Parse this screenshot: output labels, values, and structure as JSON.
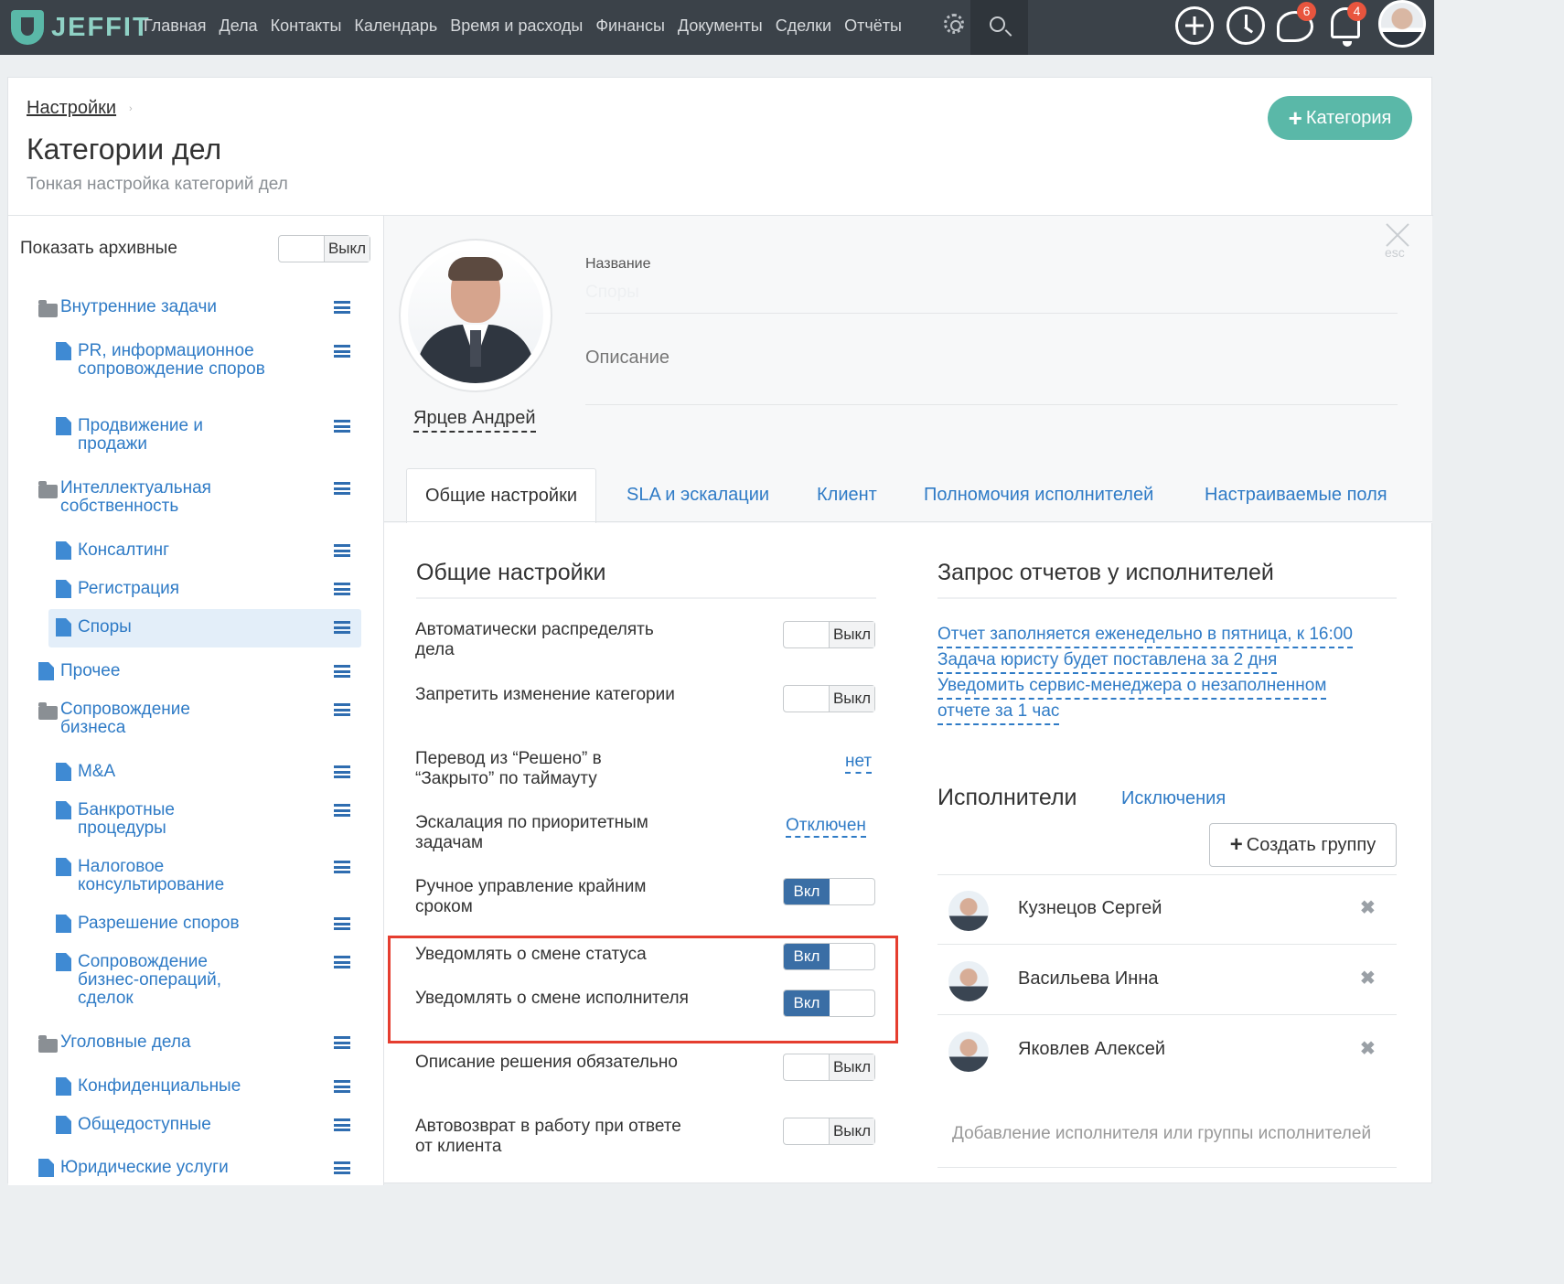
{
  "app": {
    "brand": "JEFFIT"
  },
  "nav": [
    "Главная",
    "Дела",
    "Контакты",
    "Календарь",
    "Время и расходы",
    "Финансы",
    "Документы",
    "Сделки",
    "Отчёты"
  ],
  "badges": {
    "messages": "6",
    "notifications": "4"
  },
  "page": {
    "breadcrumb": "Настройки",
    "breadcrumb_sep": "›",
    "title": "Категории дел",
    "subtitle": "Тонкая настройка категорий дел",
    "add_button_icon": "+",
    "add_button": "Категория"
  },
  "sidebar": {
    "show_archived": "Показать архивные",
    "archived_toggle": "Выкл",
    "items": [
      "Внутренние задачи",
      "PR, информационное сопровождение споров",
      "Продвижение и продажи",
      "Интеллектуальная собственность",
      "Консалтинг",
      "Регистрация",
      "Споры",
      "Прочее",
      "Сопровождение бизнеса",
      "M&A",
      "Банкротные процедуры",
      "Налоговое консультирование",
      "Разрешение споров",
      "Сопровождение бизнес-операций, сделок",
      "Уголовные дела",
      "Конфиденциальные",
      "Общедоступные",
      "Юридические услуги"
    ],
    "selected": "Споры"
  },
  "detail": {
    "owner": "Ярцев Андрей",
    "name_label": "Название",
    "name_value": "Споры",
    "description_placeholder": "Описание",
    "esc": "esc"
  },
  "tabs": [
    "Общие настройки",
    "SLA и эскалации",
    "Клиент",
    "Полномочия исполнителей",
    "Настраиваемые поля"
  ],
  "general": {
    "title": "Общие настройки",
    "rows": [
      {
        "label": "Автоматически распределять дела",
        "value": "Выкл"
      },
      {
        "label": "Запретить изменение категории",
        "value": "Выкл"
      },
      {
        "label": "Перевод из “Решено” в “Закрыто” по таймауту",
        "value": "нет"
      },
      {
        "label": "Эскалация по приоритетным задачам",
        "value": "Отключен"
      },
      {
        "label": "Ручное управление крайним сроком",
        "value": "Вкл"
      },
      {
        "label": "Уведомлять о смене статуса",
        "value": "Вкл"
      },
      {
        "label": "Уведомлять о смене исполнителя",
        "value": "Вкл"
      },
      {
        "label": "Описание решения обязательно",
        "value": "Выкл"
      },
      {
        "label": "Автовозврат в работу при ответе от клиента",
        "value": "Выкл"
      }
    ]
  },
  "reports": {
    "title": "Запрос отчетов у исполнителей",
    "lines": [
      "Отчет заполняется еженедельно в пятница, к 16:00",
      "Задача юристу будет поставлена за 2 дня",
      "Уведомить сервис-менеджера о незаполненном",
      "отчете за 1 час"
    ]
  },
  "executors": {
    "title": "Исполнители",
    "exceptions": "Исключения",
    "create_icon": "+",
    "create_group": "Создать группу",
    "remove_icon": "✖",
    "list": [
      "Кузнецов Сергей",
      "Васильева Инна",
      "Яковлев Алексей"
    ],
    "add_placeholder": "Добавление исполнителя или группы исполнителей"
  }
}
